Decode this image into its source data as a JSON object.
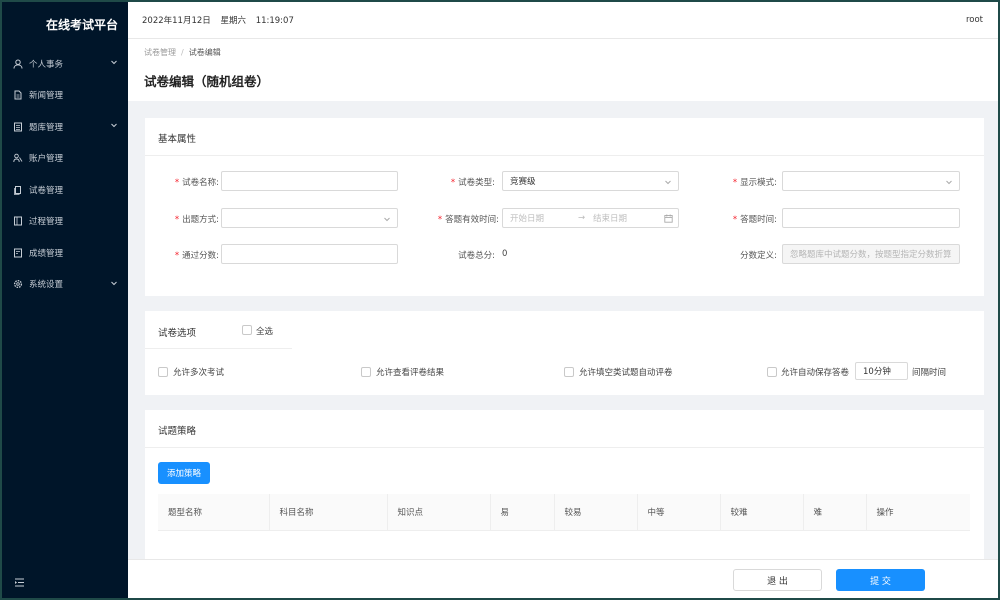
{
  "app": {
    "title": "在线考试平台"
  },
  "sidebar": {
    "items": [
      {
        "label": "个人事务",
        "icon": "user-icon",
        "expandable": true
      },
      {
        "label": "新闻管理",
        "icon": "document-icon",
        "expandable": false
      },
      {
        "label": "题库管理",
        "icon": "list-icon",
        "expandable": true
      },
      {
        "label": "账户管理",
        "icon": "users-icon",
        "expandable": false
      },
      {
        "label": "试卷管理",
        "icon": "paper-icon",
        "expandable": false
      },
      {
        "label": "过程管理",
        "icon": "book-icon",
        "expandable": false
      },
      {
        "label": "成绩管理",
        "icon": "grade-icon",
        "expandable": false
      },
      {
        "label": "系统设置",
        "icon": "gear-icon",
        "expandable": true
      }
    ]
  },
  "header": {
    "date": "2022年11月12日",
    "weekday": "星期六",
    "time": "11:19:07",
    "user": "root"
  },
  "breadcrumb": {
    "parent": "试卷管理",
    "sep": "/",
    "current": "试卷编辑"
  },
  "page": {
    "title": "试卷编辑（随机组卷）"
  },
  "basic": {
    "title": "基本属性",
    "name_label": "试卷名称:",
    "type_label": "试卷类型:",
    "type_value": "竞赛级",
    "display_label": "显示模式:",
    "method_label": "出题方式:",
    "valid_label": "答题有效时间:",
    "start_placeholder": "开始日期",
    "range_arrow": "→",
    "end_placeholder": "结束日期",
    "duration_label": "答题时间:",
    "pass_label": "通过分数:",
    "total_label": "试卷总分:",
    "total_value": "0",
    "score_def_label": "分数定义:",
    "score_def_placeholder": "忽略题库中试题分数，按题型指定分数折算"
  },
  "options": {
    "title": "试卷选项",
    "select_all": "全选",
    "multi_exam": "允许多次考试",
    "view_result": "允许查看评卷结果",
    "auto_grade": "允许填空类试题自动评卷",
    "auto_save": "允许自动保存答卷",
    "interval_value": "10分钟",
    "interval_suffix": "间隔时间"
  },
  "strategy": {
    "title": "试题策略",
    "add_button": "添加策略",
    "columns": [
      "题型名称",
      "科目名称",
      "知识点",
      "易",
      "较易",
      "中等",
      "较难",
      "难",
      "操作"
    ]
  },
  "footer": {
    "exit": "退 出",
    "submit": "提 交"
  },
  "colors": {
    "sidebar": "#001529",
    "primary": "#1890ff",
    "required": "#f5222d"
  }
}
